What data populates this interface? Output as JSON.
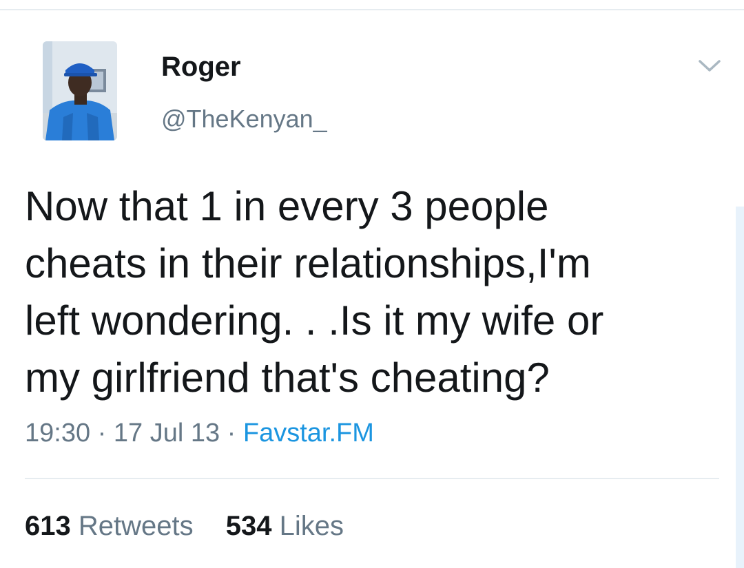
{
  "tweet": {
    "author": {
      "display_name": "Roger",
      "handle": "@TheKenyan_"
    },
    "text": "Now that 1 in every 3 people\ncheats in their relationships,I'm\nleft wondering. . .Is it my wife or\nmy girlfriend that's cheating?",
    "meta": {
      "time": "19:30",
      "separator": "·",
      "date": "17 Jul 13",
      "source": "Favstar.FM"
    },
    "stats": {
      "retweets_count": "613",
      "retweets_label": "Retweets",
      "likes_count": "534",
      "likes_label": "Likes"
    }
  },
  "icons": {
    "menu_caret": "chevron-down-icon"
  },
  "colors": {
    "text_primary": "#14171a",
    "text_secondary": "#657786",
    "link": "#1b95e0",
    "divider": "#e6ecf0",
    "caret": "#aab8c2"
  }
}
